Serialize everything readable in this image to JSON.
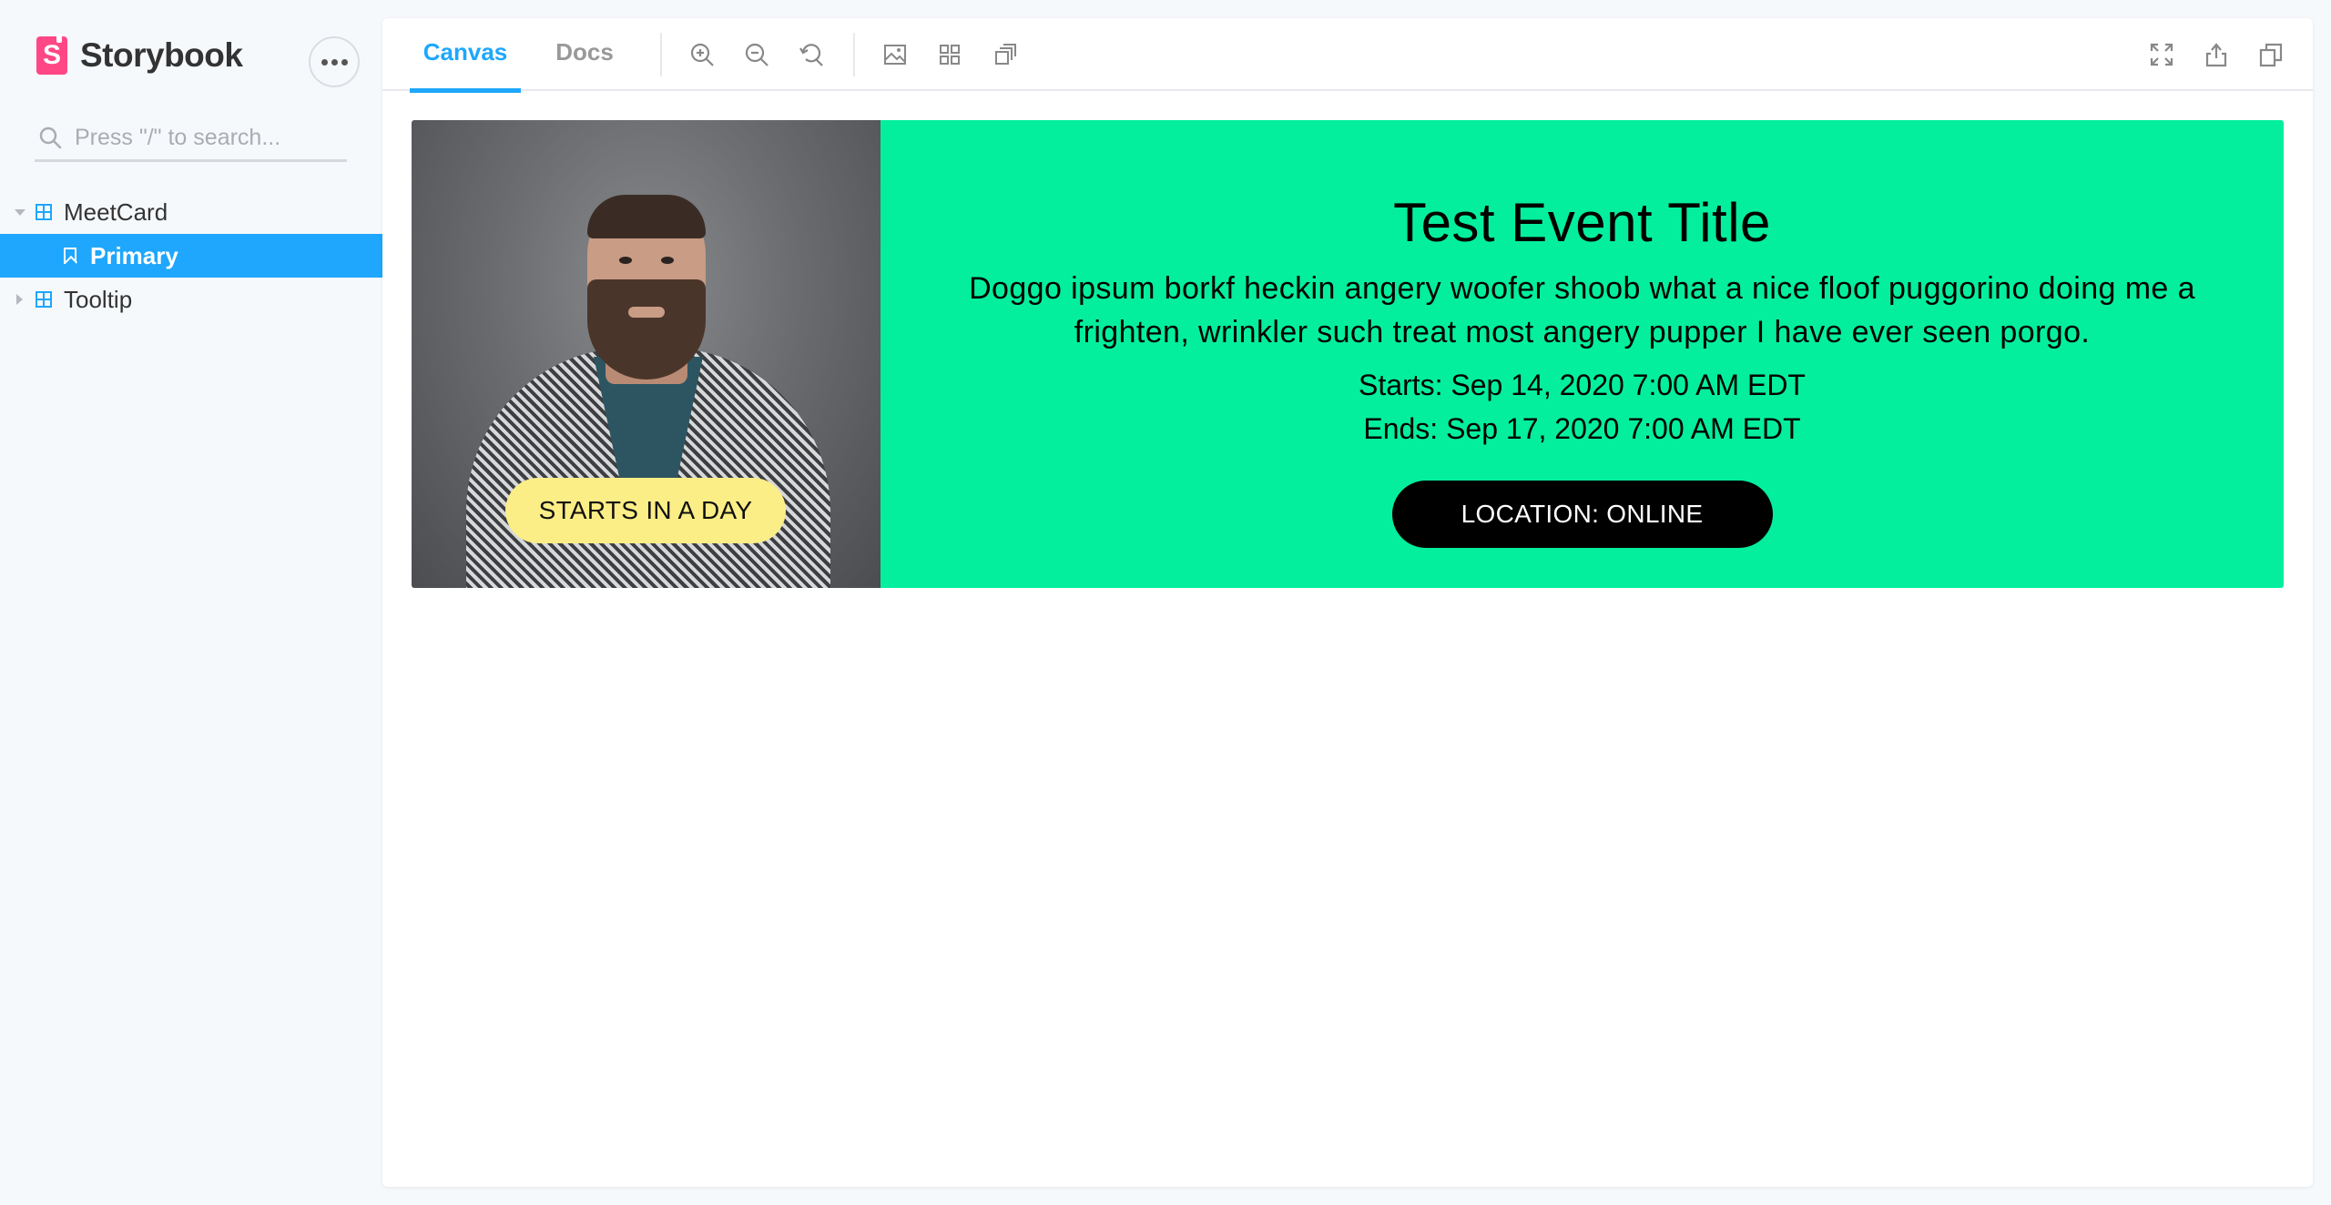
{
  "app": {
    "brand_name": "Storybook",
    "accent_color": "#1ea7fd",
    "brand_color": "#ff4785"
  },
  "sidebar": {
    "search_placeholder": "Press \"/\" to search...",
    "tree": [
      {
        "label": "MeetCard",
        "type": "component",
        "expanded": true
      },
      {
        "label": "Primary",
        "type": "story",
        "selected": true
      },
      {
        "label": "Tooltip",
        "type": "component",
        "expanded": false
      }
    ]
  },
  "toolbar": {
    "tabs": [
      {
        "label": "Canvas",
        "active": true
      },
      {
        "label": "Docs",
        "active": false
      }
    ],
    "icons": [
      "zoom-in-icon",
      "zoom-out-icon",
      "zoom-reset-icon",
      "background-icon",
      "grid-icon",
      "outline-icon",
      "fullscreen-icon",
      "share-icon",
      "copy-link-icon"
    ]
  },
  "story": {
    "badge": "STARTS IN A DAY",
    "title": "Test Event Title",
    "description": "Doggo ipsum borkf heckin angery woofer shoob what a nice floof puggorino doing me a frighten, wrinkler such treat most angery pupper I have ever seen porgo.",
    "starts": "Starts: Sep 14, 2020 7:00 AM EDT",
    "ends": "Ends: Sep 17, 2020 7:00 AM EDT",
    "location_button": "LOCATION: ONLINE",
    "card_color": "#03ef9e",
    "badge_color": "#fcee86"
  }
}
